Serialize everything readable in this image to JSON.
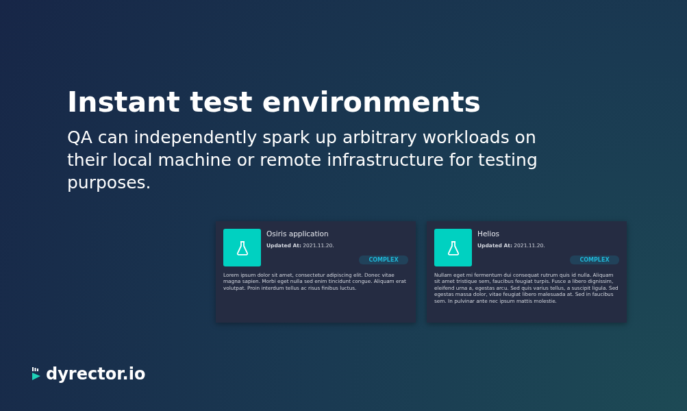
{
  "hero": {
    "title": "Instant test environments",
    "subtitle": "QA can independently spark up arbitrary workloads on their local machine or remote infrastructure for testing purposes."
  },
  "cards": [
    {
      "name": "Osiris application",
      "updated_label": "Updated At:",
      "updated_value": "2021.11.20.",
      "badge": "COMPLEX",
      "description": "Lorem ipsum dolor sit amet, consectetur adipiscing elit. Donec vitae magna sapien. Morbi eget nulla sed enim tincidunt congue. Aliquam erat volutpat. Proin interdum tellus ac risus finibus luctus."
    },
    {
      "name": "Helios",
      "updated_label": "Updated At:",
      "updated_value": "2021.11.20.",
      "badge": "COMPLEX",
      "description": "Nullam eget mi fermentum dui consequat rutrum quis id nulla. Aliquam sit amet tristique sem, faucibus feugiat turpis. Fusce a libero dignissim, eleifend urna a, egestas arcu. Sed quis varius tellus, a suscipit ligula. Sed egestas massa dolor, vitae feugiat libero malesuada at. Sed in faucibus sem. In pulvinar ante nec ipsum mattis molestie."
    }
  ],
  "brand": {
    "name": "dyrector.io"
  }
}
